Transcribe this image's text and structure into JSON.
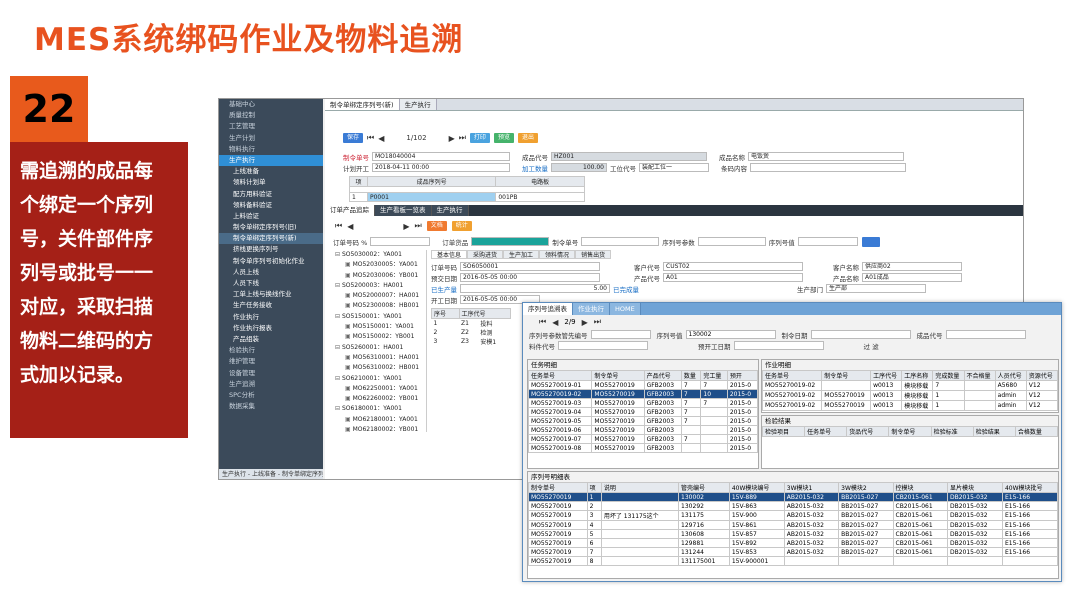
{
  "slide": {
    "title": "MES系统绑码作业及物料追溯",
    "number": "22",
    "description_lines": [
      "需追溯的成品每",
      "个绑定一个序列",
      "号，关件部件序",
      "列号或批号一一",
      "对应，采取扫描",
      "物料二维码的方",
      "式加以记录。"
    ]
  },
  "sidebar": {
    "items": [
      {
        "label": "基础中心",
        "type": "top"
      },
      {
        "label": "质量控制",
        "type": "top"
      },
      {
        "label": "工艺管理",
        "type": "top"
      },
      {
        "label": "生产计划",
        "type": "top"
      },
      {
        "label": "物料执行",
        "type": "top"
      },
      {
        "label": "生产执行",
        "type": "active"
      },
      {
        "label": "上线准备",
        "type": "sub"
      },
      {
        "label": "领料计划单",
        "type": "sub"
      },
      {
        "label": "配方用料验证",
        "type": "sub"
      },
      {
        "label": "领料备料验证",
        "type": "sub"
      },
      {
        "label": "上料验证",
        "type": "sub"
      },
      {
        "label": "制令单绑定序列号(旧)",
        "type": "sub"
      },
      {
        "label": "制令单绑定序列号(新)",
        "type": "sub-sel"
      },
      {
        "label": "挤栈更换序列号",
        "type": "sub"
      },
      {
        "label": "制令单序列号初始化作业",
        "type": "sub"
      },
      {
        "label": "人员上线",
        "type": "sub"
      },
      {
        "label": "人员下线",
        "type": "sub"
      },
      {
        "label": "工单上线与换线作业",
        "type": "sub"
      },
      {
        "label": "生产任务接收",
        "type": "sub"
      },
      {
        "label": "作业执行",
        "type": "sub"
      },
      {
        "label": "作业执行报表",
        "type": "sub"
      },
      {
        "label": "产品组装",
        "type": "sub"
      },
      {
        "label": "检验执行",
        "type": "top"
      },
      {
        "label": "维护管理",
        "type": "top"
      },
      {
        "label": "设备管理",
        "type": "top"
      },
      {
        "label": "生产追溯",
        "type": "top"
      },
      {
        "label": "SPC分析",
        "type": "top"
      },
      {
        "label": "数据采集",
        "type": "top"
      }
    ],
    "status": "生产执行 - 上线准备 - 制令单绑定序列号(新) - 生产执行"
  },
  "tabs": [
    "制令单绑定序列号(新)",
    "生产执行"
  ],
  "toolbar": {
    "buttons": [
      {
        "label": "保存",
        "color": "#3a7bd5"
      },
      {
        "label": "打印",
        "color": "#4aa3df"
      },
      {
        "label": "预览",
        "color": "#45b36b"
      },
      {
        "label": "退出",
        "color": "#f0a030"
      }
    ],
    "page": "1/102"
  },
  "header_form": {
    "order_no_label": "制令单号",
    "order_no": "MO18040004",
    "product_code_label": "成品代号",
    "product_code": "HZ001",
    "product_name_label": "成品名称",
    "product_name": "电饭煲",
    "plan_start_label": "计划开工",
    "plan_start": "2018-04-11 00:00",
    "qty_label": "加工数量",
    "qty": "100.00",
    "work_center_label": "工位代号",
    "work_center": "装配工位一",
    "barcode_label": "条码内容",
    "barcode": ""
  },
  "bind_table": {
    "headers": [
      "项",
      "成品序列号",
      "电路板"
    ],
    "rows": [
      [
        "1",
        "P0001",
        "001PB"
      ]
    ]
  },
  "sub_tabs": [
    "订单产品追踪",
    "生产看板一览表",
    "生产执行"
  ],
  "order_search": {
    "label": "订单号码 %",
    "query_label": "订单货品",
    "mo_label": "制令单号",
    "serial_param_label": "序列号参数",
    "serial_val_label": "序列号值"
  },
  "mini_toolbar": [
    "文档",
    "统计"
  ],
  "tree_nodes": [
    "SO5030002：YA001",
    "MO52030005：YA001",
    "MO52030006：YB001",
    "SO5200003：HA001",
    "MO52000007：HA001",
    "MO52300008：HB001",
    "SO5150001：YA001",
    "MO5150001：YA001",
    "MO5150002：YB001",
    "SO5260001：HA001",
    "MO56310001：HA001",
    "MO56310002：HB001",
    "SO6210001：YA001",
    "MO62250001：YA001",
    "MO62260002：YB001",
    "SO6180001：YA001",
    "MO62180001：YA001",
    "MO62180002：YB001",
    "SO6190001：YA001",
    "MO62240001：YA001",
    "MO62240002：YB001",
    "SO6410001：A01",
    "MO64110001：A01",
    "MO64110002：B01",
    "MO64110003：C01",
    "SO64260001：C01",
    "SO6050001：A01",
    "MO6050001：A01",
    "MO6050002：B01",
    "MO6050003：C01"
  ],
  "detail_tabs": [
    "基本信息",
    "采购进货",
    "生产加工",
    "领料情况",
    "销售出货"
  ],
  "detail": {
    "order_label": "订单号码",
    "order": "SO6050001",
    "cust_label": "客户代号",
    "cust": "CUST02",
    "cust_name_label": "客户名称",
    "cust_name": "供应商02",
    "plan_date_label": "预交日期",
    "plan_date": "2016-05-05 00:00",
    "prod_label": "产品代号",
    "prod": "A01",
    "prod_name_label": "产品名称",
    "prod_name": "A01成品",
    "produced_label": "已生产量",
    "produced": "5.00",
    "produced_state": "已完成量",
    "dept_label": "生产部门",
    "dept": "生产部",
    "start_label": "开工日期",
    "start": "2016-05-05 00:00"
  },
  "process_table": {
    "headers": [
      "序号",
      "工序代号"
    ],
    "rows": [
      [
        "1",
        "Z1",
        "投料"
      ],
      [
        "2",
        "Z2",
        "检测"
      ],
      [
        "3",
        "Z3",
        "安模1"
      ]
    ]
  },
  "popup": {
    "tabs": [
      "序列号追溯表",
      "作业执行",
      "HOME"
    ],
    "page": "2/9",
    "param_label": "序列号参数管先编号",
    "serial_label": "序列号值",
    "serial": "130002",
    "mo_label": "制令日期",
    "product_label": "成品代号",
    "material_label": "料件代号",
    "finish_label": "预开工日期",
    "filter_label": "过  滤",
    "task_title": "任务明细",
    "task_headers": [
      "任务单号",
      "制令单号",
      "产品代号",
      "数量",
      "完工量",
      "预开"
    ],
    "task_rows": [
      [
        "MO55270019-01",
        "MO55270019",
        "GFB2003",
        "7",
        "7",
        "2015-0"
      ],
      [
        "MO55270019-02",
        "MO55270019",
        "GFB2003",
        "7",
        "10",
        "2015-0"
      ],
      [
        "MO55270019-03",
        "MO55270019",
        "GFB2003",
        "7",
        "7",
        "2015-0"
      ],
      [
        "MO55270019-04",
        "MO55270019",
        "GFB2003",
        "7",
        "",
        "2015-0"
      ],
      [
        "MO55270019-05",
        "MO55270019",
        "GFB2003",
        "7",
        "",
        "2015-0"
      ],
      [
        "MO55270019-06",
        "MO55270019",
        "GFB2003",
        "",
        "",
        "2015-0"
      ],
      [
        "MO55270019-07",
        "MO55270019",
        "GFB2003",
        "7",
        "",
        "2015-0"
      ],
      [
        "MO55270019-08",
        "MO55270019",
        "GFB2003",
        "",
        "",
        "2015-0"
      ]
    ],
    "work_title": "作业明细",
    "work_headers": [
      "任务单号",
      "制令单号",
      "工序代号",
      "工序名称",
      "完成数量",
      "不合格量",
      "人员代号",
      "资源代号"
    ],
    "work_rows": [
      [
        "MO55270019-02",
        "",
        "w0013",
        "模块移载",
        "7",
        "",
        "A5680",
        "V12"
      ],
      [
        "MO55270019-02",
        "MO55270019",
        "w0013",
        "模块移载",
        "1",
        "",
        "admin",
        "V12"
      ],
      [
        "MO55270019-02",
        "MO55270019",
        "w0013",
        "模块移载",
        "1",
        "",
        "admin",
        "V12"
      ]
    ],
    "check_title": "检验结果",
    "check_headers": [
      "检验项目",
      "任务单号",
      "货品代号",
      "制令单号",
      "检验标准",
      "检验结果",
      "合格数量"
    ],
    "serial_title": "序列号明细表",
    "serial_headers": [
      "制令单号",
      "项",
      "说明",
      "管壳编号",
      "40W模块编号",
      "3W模块1",
      "3W模块2",
      "控模块",
      "显片模块",
      "40W模块批号"
    ],
    "serial_rows": [
      [
        "MO55270019",
        "1",
        "",
        "130002",
        "15V-889",
        "AB2015-032",
        "BB2015-027",
        "CB2015-061",
        "DB2015-032",
        "E15-166"
      ],
      [
        "MO55270019",
        "2",
        "",
        "130292",
        "15V-863",
        "AB2015-032",
        "BB2015-027",
        "CB2015-061",
        "DB2015-032",
        "E15-166"
      ],
      [
        "MO55270019",
        "3",
        "用坏了 131175这个",
        "131175",
        "15V-900",
        "AB2015-032",
        "BB2015-027",
        "CB2015-061",
        "DB2015-032",
        "E15-166"
      ],
      [
        "MO55270019",
        "4",
        "",
        "129716",
        "15V-861",
        "AB2015-032",
        "BB2015-027",
        "CB2015-061",
        "DB2015-032",
        "E15-166"
      ],
      [
        "MO55270019",
        "5",
        "",
        "130608",
        "15V-857",
        "AB2015-032",
        "BB2015-027",
        "CB2015-061",
        "DB2015-032",
        "E15-166"
      ],
      [
        "MO55270019",
        "6",
        "",
        "129881",
        "15V-892",
        "AB2015-032",
        "BB2015-027",
        "CB2015-061",
        "DB2015-032",
        "E15-166"
      ],
      [
        "MO55270019",
        "7",
        "",
        "131244",
        "15V-853",
        "AB2015-032",
        "BB2015-027",
        "CB2015-061",
        "DB2015-032",
        "E15-166"
      ],
      [
        "MO55270019",
        "8",
        "",
        "131175001",
        "15V-900001",
        "",
        "",
        "",
        "",
        ""
      ]
    ]
  }
}
